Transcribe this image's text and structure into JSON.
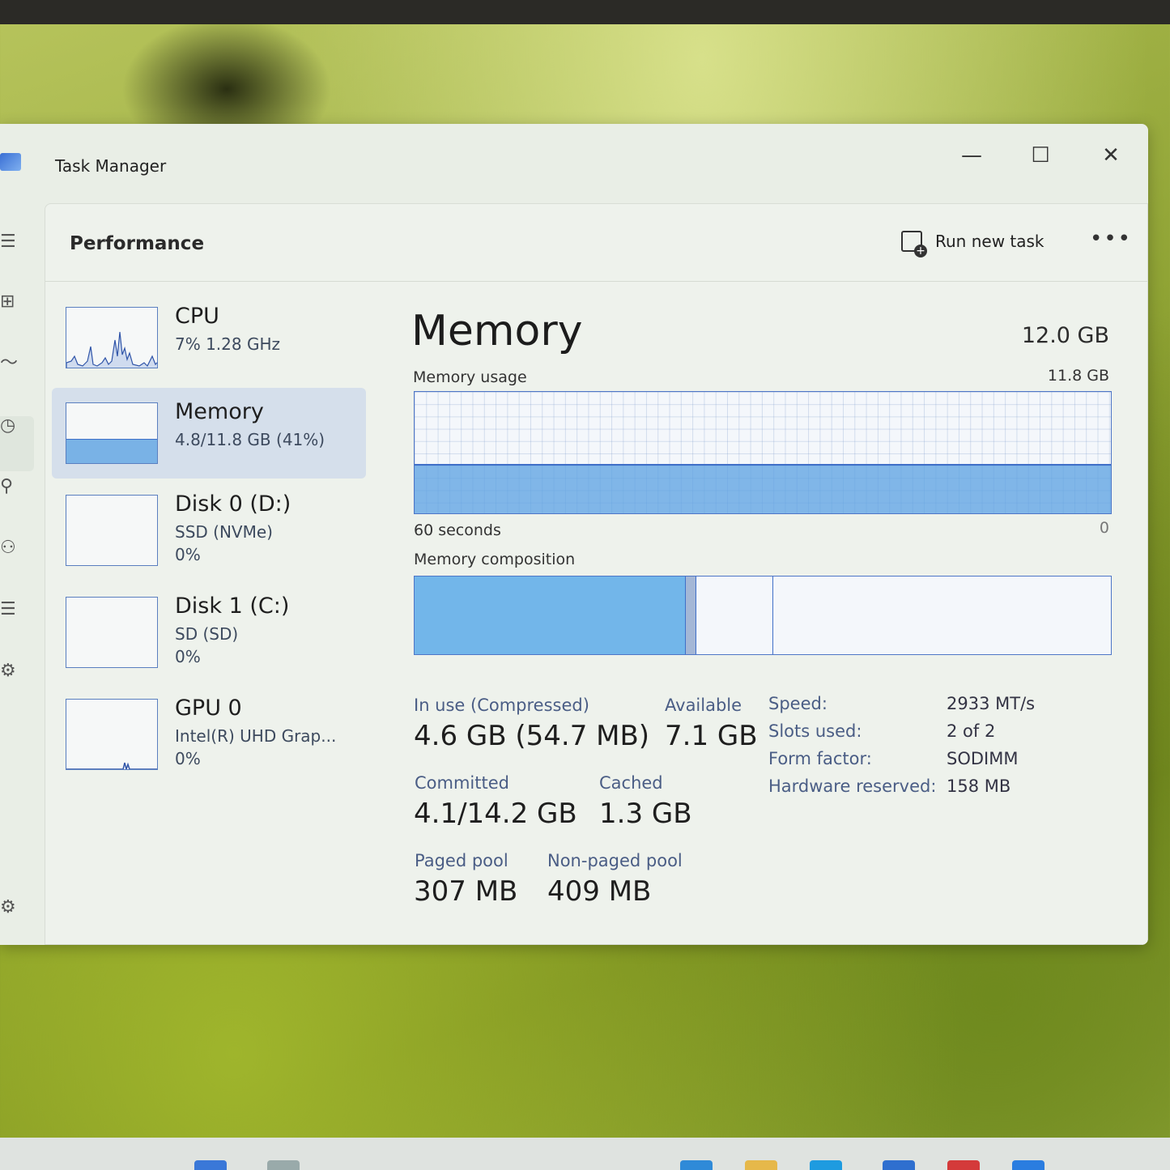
{
  "window": {
    "title": "Task Manager",
    "minimize_glyph": "—",
    "maximize_glyph": "☐",
    "close_glyph": "✕"
  },
  "nav": {
    "icons": [
      "hamburger-icon",
      "processes-icon",
      "performance-icon",
      "app-history-icon",
      "startup-apps-icon",
      "users-icon",
      "details-icon",
      "services-icon",
      "settings-icon"
    ],
    "glyphs": {
      "hamburger": "☰",
      "processes": "⊞",
      "performance": "〜",
      "app_history": "◷",
      "startup": "⚲",
      "users": "⚇",
      "details": "☰",
      "services": "⚙",
      "settings": "⚙"
    }
  },
  "header": {
    "page_title": "Performance",
    "run_new_task": "Run new task",
    "more": "•••"
  },
  "devices": [
    {
      "name": "CPU",
      "line1": "7%  1.28 GHz",
      "line2": ""
    },
    {
      "name": "Memory",
      "line1": "4.8/11.8 GB (41%)",
      "line2": ""
    },
    {
      "name": "Disk 0 (D:)",
      "line1": "SSD (NVMe)",
      "line2": "0%"
    },
    {
      "name": "Disk 1 (C:)",
      "line1": "SD (SD)",
      "line2": "0%"
    },
    {
      "name": "GPU 0",
      "line1": "Intel(R) UHD Grap...",
      "line2": "0%"
    }
  ],
  "memory": {
    "title": "Memory",
    "total": "12.0 GB",
    "usage_label": "Memory usage",
    "usage_max": "11.8 GB",
    "time_label": "60 seconds",
    "zero_label": "0",
    "usage_fraction": 0.41,
    "composition_label": "Memory composition",
    "composition": {
      "in_use_fraction": 0.39,
      "modified_fraction": 0.015,
      "standby_fraction": 0.11
    },
    "stats": {
      "in_use_label": "In use (Compressed)",
      "in_use_value": "4.6 GB (54.7 MB)",
      "available_label": "Available",
      "available_value": "7.1 GB",
      "committed_label": "Committed",
      "committed_value": "4.1/14.2 GB",
      "cached_label": "Cached",
      "cached_value": "1.3 GB",
      "paged_pool_label": "Paged pool",
      "paged_pool_value": "307 MB",
      "non_paged_pool_label": "Non-paged pool",
      "non_paged_pool_value": "409 MB"
    },
    "specs": [
      {
        "label": "Speed:",
        "value": "2933 MT/s"
      },
      {
        "label": "Slots used:",
        "value": "2 of 2"
      },
      {
        "label": "Form factor:",
        "value": "SODIMM"
      },
      {
        "label": "Hardware reserved:",
        "value": "158 MB"
      }
    ]
  },
  "colors": {
    "accent": "#4e76c7",
    "fill": "#5aa0e1",
    "selected_bg": "#d5dfeb"
  }
}
